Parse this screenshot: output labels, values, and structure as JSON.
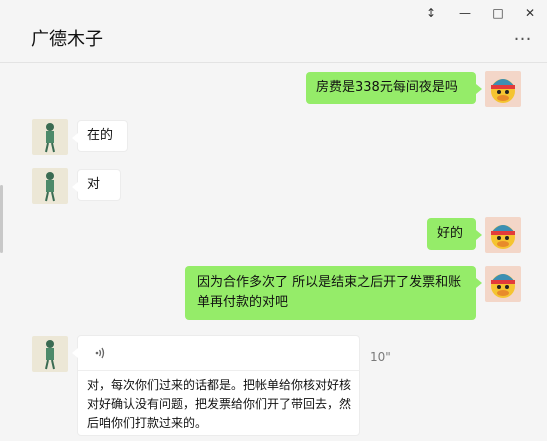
{
  "window": {
    "title": "广德木子",
    "controls": {
      "pin": "↕",
      "minimize": "—",
      "maximize": "□",
      "close": "✕"
    },
    "more": "…"
  },
  "colors": {
    "bubble_self": "#95ec69",
    "bubble_other": "#ffffff",
    "background": "#f5f5f5"
  },
  "messages": [
    {
      "sender": "self",
      "text": "房费是338元每间夜是吗"
    },
    {
      "sender": "other",
      "text": "在的"
    },
    {
      "sender": "other",
      "text": "对"
    },
    {
      "sender": "self",
      "text": "好的"
    },
    {
      "sender": "self",
      "text": "因为合作多次了 所以是结束之后开了发票和账单再付款的对吧"
    },
    {
      "sender": "other",
      "type": "voice",
      "duration": "10\"",
      "icon": "voice-wave-icon",
      "transcript": "对，每次你们过来的话都是。把帐单给你核对好核对好确认没有问题，把发票给你们开了带回去，然后咱你们打款过来的。"
    }
  ]
}
